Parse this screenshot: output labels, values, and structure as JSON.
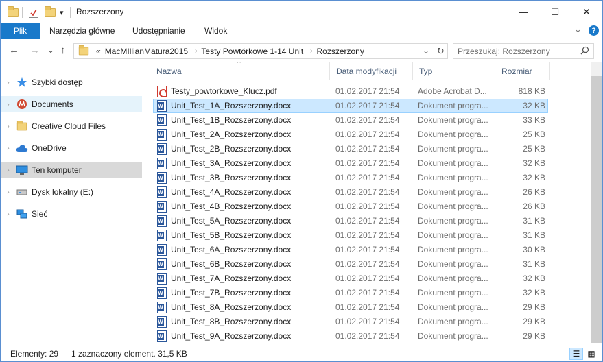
{
  "window": {
    "title": "Rozszerzony"
  },
  "titlebar": {
    "dropdown_glyph": "▾"
  },
  "window_controls": {
    "minimize": "—",
    "maximize": "☐",
    "close": "✕"
  },
  "ribbon": {
    "tabs": [
      "Plik",
      "Narzędzia główne",
      "Udostępnianie",
      "Widok"
    ],
    "expand_glyph": "⌄",
    "help_glyph": "?"
  },
  "nav": {
    "back_glyph": "←",
    "forward_glyph": "→",
    "recent_glyph": "⌄",
    "up_glyph": "↑",
    "breadcrumb_prefix": "«",
    "breadcrumbs": [
      "MacMIllianMatura2015",
      "Testy Powtórkowe 1-14 Unit",
      "Rozszerzony"
    ],
    "crumb_sep": "›",
    "dropdown_glyph": "⌄",
    "refresh_glyph": "↻",
    "search_placeholder": "Przeszukaj: Rozszerzony"
  },
  "sidebar": {
    "items": [
      {
        "label": "Szybki dostęp",
        "icon": "star-icon"
      },
      {
        "label": "Documents",
        "icon": "documents-icon"
      },
      {
        "label": "Creative Cloud Files",
        "icon": "folder-icon"
      },
      {
        "label": "OneDrive",
        "icon": "cloud-icon"
      },
      {
        "label": "Ten komputer",
        "icon": "computer-icon"
      },
      {
        "label": "Dysk lokalny (E:)",
        "icon": "drive-icon"
      },
      {
        "label": "Sieć",
        "icon": "network-icon"
      }
    ]
  },
  "columns": {
    "name": "Nazwa",
    "date": "Data modyfikacji",
    "type": "Typ",
    "size": "Rozmiar",
    "sort_glyph": "^"
  },
  "files": [
    {
      "name": "Testy_powtorkowe_Klucz.pdf",
      "date": "01.02.2017 21:54",
      "type": "Adobe Acrobat D...",
      "size": "818 KB",
      "kind": "pdf"
    },
    {
      "name": "Unit_Test_1A_Rozszerzony.docx",
      "date": "01.02.2017 21:54",
      "type": "Dokument progra...",
      "size": "32 KB",
      "kind": "docx",
      "selected": true
    },
    {
      "name": "Unit_Test_1B_Rozszerzony.docx",
      "date": "01.02.2017 21:54",
      "type": "Dokument progra...",
      "size": "33 KB",
      "kind": "docx"
    },
    {
      "name": "Unit_Test_2A_Rozszerzony.docx",
      "date": "01.02.2017 21:54",
      "type": "Dokument progra...",
      "size": "25 KB",
      "kind": "docx"
    },
    {
      "name": "Unit_Test_2B_Rozszerzony.docx",
      "date": "01.02.2017 21:54",
      "type": "Dokument progra...",
      "size": "25 KB",
      "kind": "docx"
    },
    {
      "name": "Unit_Test_3A_Rozszerzony.docx",
      "date": "01.02.2017 21:54",
      "type": "Dokument progra...",
      "size": "32 KB",
      "kind": "docx"
    },
    {
      "name": "Unit_Test_3B_Rozszerzony.docx",
      "date": "01.02.2017 21:54",
      "type": "Dokument progra...",
      "size": "32 KB",
      "kind": "docx"
    },
    {
      "name": "Unit_Test_4A_Rozszerzony.docx",
      "date": "01.02.2017 21:54",
      "type": "Dokument progra...",
      "size": "26 KB",
      "kind": "docx"
    },
    {
      "name": "Unit_Test_4B_Rozszerzony.docx",
      "date": "01.02.2017 21:54",
      "type": "Dokument progra...",
      "size": "26 KB",
      "kind": "docx"
    },
    {
      "name": "Unit_Test_5A_Rozszerzony.docx",
      "date": "01.02.2017 21:54",
      "type": "Dokument progra...",
      "size": "31 KB",
      "kind": "docx"
    },
    {
      "name": "Unit_Test_5B_Rozszerzony.docx",
      "date": "01.02.2017 21:54",
      "type": "Dokument progra...",
      "size": "31 KB",
      "kind": "docx"
    },
    {
      "name": "Unit_Test_6A_Rozszerzony.docx",
      "date": "01.02.2017 21:54",
      "type": "Dokument progra...",
      "size": "30 KB",
      "kind": "docx"
    },
    {
      "name": "Unit_Test_6B_Rozszerzony.docx",
      "date": "01.02.2017 21:54",
      "type": "Dokument progra...",
      "size": "31 KB",
      "kind": "docx"
    },
    {
      "name": "Unit_Test_7A_Rozszerzony.docx",
      "date": "01.02.2017 21:54",
      "type": "Dokument progra...",
      "size": "32 KB",
      "kind": "docx"
    },
    {
      "name": "Unit_Test_7B_Rozszerzony.docx",
      "date": "01.02.2017 21:54",
      "type": "Dokument progra...",
      "size": "32 KB",
      "kind": "docx"
    },
    {
      "name": "Unit_Test_8A_Rozszerzony.docx",
      "date": "01.02.2017 21:54",
      "type": "Dokument progra...",
      "size": "29 KB",
      "kind": "docx"
    },
    {
      "name": "Unit_Test_8B_Rozszerzony.docx",
      "date": "01.02.2017 21:54",
      "type": "Dokument progra...",
      "size": "29 KB",
      "kind": "docx"
    },
    {
      "name": "Unit_Test_9A_Rozszerzony.docx",
      "date": "01.02.2017 21:54",
      "type": "Dokument progra...",
      "size": "29 KB",
      "kind": "docx"
    }
  ],
  "status": {
    "count": "Elementy: 29",
    "selection": "1 zaznaczony element. 31,5 KB"
  },
  "view_buttons": {
    "details": "☰",
    "tiles": "▦"
  },
  "colors": {
    "accent": "#1979ca",
    "selection_bg": "#cce8ff",
    "selection_border": "#99d1ff",
    "nav_selected": "#d9d9d9"
  }
}
